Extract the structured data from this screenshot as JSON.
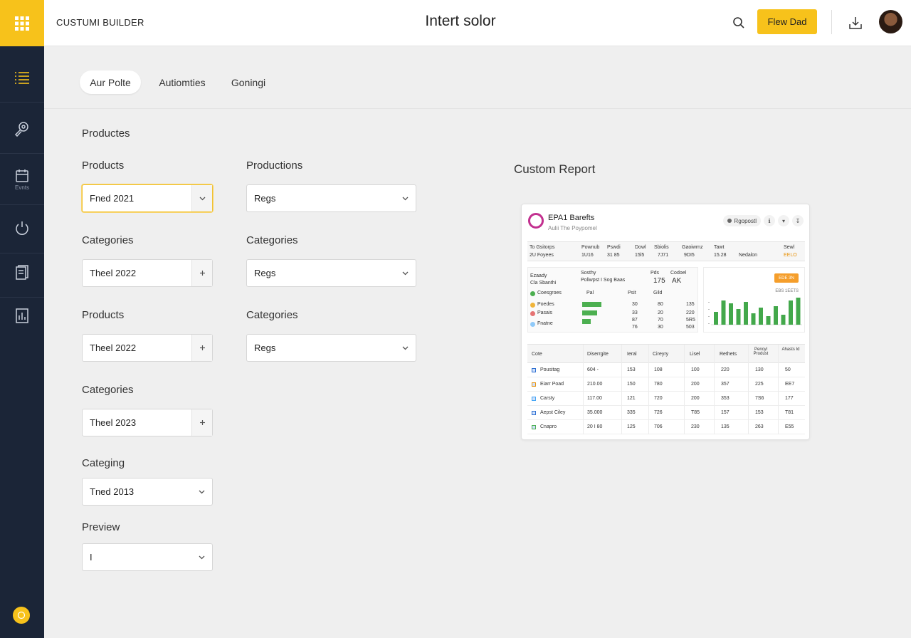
{
  "header": {
    "brand": "CUSTUMI BUILDER",
    "title": "Intert solor",
    "primary_button": "Flew Dad"
  },
  "sidebar": {
    "items": [
      {
        "icon": "list-icon"
      },
      {
        "icon": "settings-wrench-icon"
      },
      {
        "icon": "calendar-icon",
        "label": "Evnts"
      },
      {
        "icon": "power-icon"
      },
      {
        "icon": "document-icon"
      },
      {
        "icon": "report-icon"
      }
    ],
    "bottom_icon": "help-icon"
  },
  "tabs": [
    "Aur Polte",
    "Autiomties",
    "Goningi"
  ],
  "active_tab": 0,
  "form": {
    "section_title": "Productes",
    "fields": [
      {
        "label": "Products",
        "value": "Fned 2021",
        "control": "chevron"
      },
      {
        "label": "Productions",
        "value": "Regs",
        "control": "chevron"
      },
      {
        "label": "Categories",
        "value": "Theel 2022",
        "control": "plus"
      },
      {
        "label": "Categories",
        "value": "Regs",
        "control": "chevron"
      },
      {
        "label": "Products",
        "value": "Theel 2022",
        "control": "plus"
      },
      {
        "label": "Categories",
        "value": "Regs",
        "control": "chevron"
      },
      {
        "label": "Categories",
        "value": "Theel 2023",
        "control": "plus"
      },
      {
        "label": "Categing",
        "value": "Tned 2013",
        "control": "chevron"
      },
      {
        "label": "Preview",
        "value": "I",
        "control": "chevron"
      }
    ]
  },
  "report": {
    "section_title": "Custom Report",
    "card_title": "EPA1 Barefts",
    "card_subtitle": "Aulii The Poypomel",
    "chip_label": "Rgopostl",
    "summary_headers": [
      "To Gsitorps",
      "Pownub",
      "Pswdi",
      "Dowl",
      "Sbiolis",
      "Gaoiwrnz",
      "Tawt",
      "Sewl"
    ],
    "summary_values": [
      "2U Foyees",
      "1U16",
      "31 85",
      "15l5",
      "7J71",
      "9DI5",
      "15.28",
      "EELO"
    ],
    "summary_extra": "Nedalon",
    "left_panel": {
      "head_a": "Ezaady",
      "head_b": "Cla Sbanthi",
      "col1": "Sosthy",
      "col1_sub": "Poliwpst I Sog Baas",
      "col2": "Pds",
      "col3": "Codoel",
      "big1": "175",
      "big2": "AK",
      "rows": [
        {
          "label": "Coesgroes",
          "color": "#4caf50",
          "bar": 0.0,
          "a": "Pal",
          "b": "Psit",
          "c": "Gild"
        },
        {
          "label": "Poedes",
          "color": "#f0b43a",
          "bar": 0.9,
          "a": "30",
          "b": "80",
          "c": "135"
        },
        {
          "label": "Pasais",
          "color": "#e57373",
          "bar": 0.7,
          "a": "33",
          "b": "20",
          "c": "220"
        },
        {
          "label": "Fnatne",
          "color": "#90caf9",
          "bar": 0.4,
          "a": "87",
          "b": "70",
          "c": "5R5"
        }
      ],
      "extra_row": {
        "a": "76",
        "b": "30",
        "c": "503"
      }
    },
    "right_panel": {
      "badge": "EDE 3N",
      "caption": "EBS 1EETS",
      "bars": [
        0.45,
        0.85,
        0.75,
        0.55,
        0.8,
        0.4,
        0.6,
        0.3,
        0.65,
        0.35,
        0.85,
        0.95
      ]
    },
    "table": {
      "headers": [
        "Cote",
        "Diserrgite",
        "Ieral",
        "Cireyry",
        "Lisel",
        "Rethets",
        "Pencyl Produst",
        "Ahasts Id"
      ],
      "rows": [
        [
          "Pousitag",
          "604 -",
          "153",
          "108",
          "100",
          "220",
          "130",
          "50"
        ],
        [
          "Eiarr Poad",
          "210.00",
          "150",
          "780",
          "200",
          "357",
          "225",
          "EE7"
        ],
        [
          "Carsty",
          "117.00",
          "121",
          "720",
          "200",
          "353",
          "7S6",
          "177"
        ],
        [
          "Aepst Ciley",
          "35.000",
          "335",
          "726",
          "T85",
          "157",
          "153",
          "T81"
        ],
        [
          "Cnapro",
          "20 I 80",
          "125",
          "706",
          "230",
          "135",
          "263",
          "E55"
        ]
      ],
      "row_icon_colors": [
        "#2e6fd1",
        "#e8930c",
        "#42a5f5",
        "#2e6fd1",
        "#4caf50"
      ]
    }
  }
}
